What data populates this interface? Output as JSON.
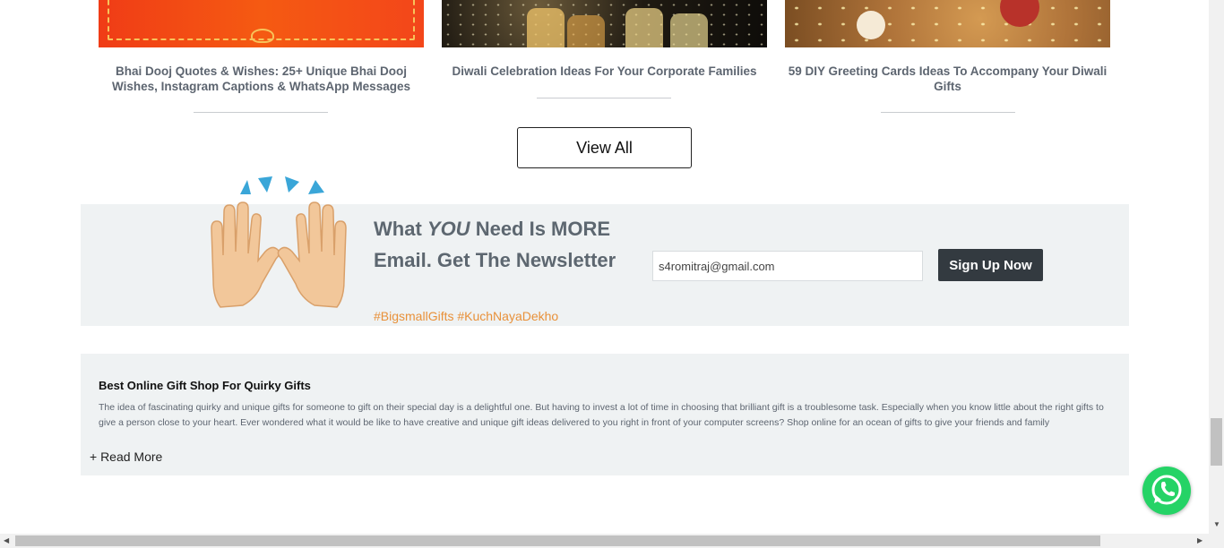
{
  "articles": [
    {
      "title": "Bhai Dooj Quotes & Wishes: 25+ Unique Bhai Dooj Wishes, Instagram Captions & WhatsApp Messages"
    },
    {
      "title": "Diwali Celebration Ideas For Your Corporate Families"
    },
    {
      "title": "59 DIY Greeting Cards Ideas To Accompany Your Diwali Gifts"
    }
  ],
  "view_all_label": "View All",
  "newsletter": {
    "title_pre": "What ",
    "title_em": "YOU",
    "title_post": " Need Is MORE Email. Get The Newsletter",
    "hashtags": "#BigsmallGifts #KuchNayaDekho",
    "email_value": "s4romitraj@gmail.com",
    "signup_label": "Sign Up Now"
  },
  "seo": {
    "title": "Best Online Gift Shop For Quirky Gifts",
    "text": "The idea of fascinating quirky and unique gifts for someone to gift on their special day is a delightful one. But having to invest a lot of time in choosing that brilliant gift is a troublesome task. Especially when you know little about the right gifts to give a person close to your heart. Ever wondered what it would be like to have creative and unique gift ideas delivered to you right in front of your computer screens? Shop online for an ocean of gifts to give your friends and family",
    "read_more": "+ Read More"
  },
  "icons": {
    "whatsapp": "whatsapp-icon",
    "hands": "raising-hands-icon"
  },
  "colors": {
    "accent_orange": "#e8913a",
    "button_dark": "#333a40",
    "whatsapp_green": "#25d366"
  }
}
